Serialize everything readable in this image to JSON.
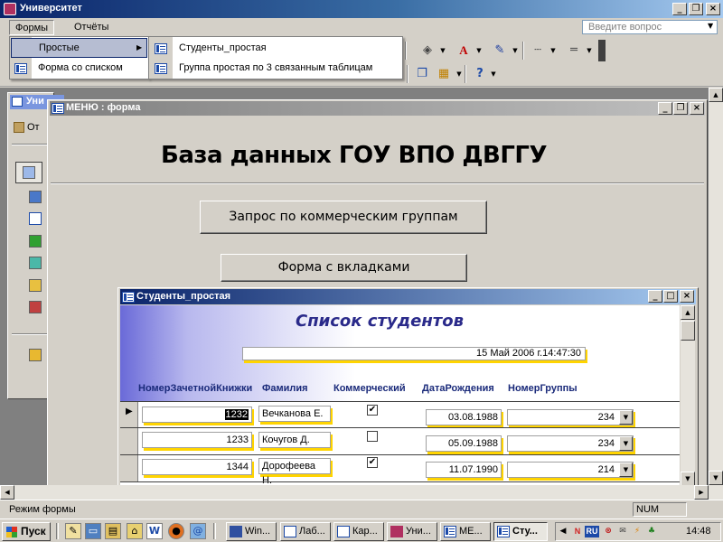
{
  "app": {
    "title": "Университет"
  },
  "menubar": {
    "forms": "Формы",
    "reports": "Отчёты",
    "help_placeholder": "Введите вопрос"
  },
  "forms_menu": {
    "simple": "Простые",
    "list_form": "Форма со списком",
    "submenu_arrow": "▶"
  },
  "simple_submenu": {
    "item1": "Студенты_простая",
    "item2": "Группа простая по 3 связанным таблицам"
  },
  "db_window": {
    "title_fragment": "Уни",
    "open_fragment": "От"
  },
  "menu_form": {
    "title": "МЕНЮ : форма",
    "heading": "База данных ГОУ ВПО ДВГГУ",
    "btn_query": "Запрос по коммерческим группам",
    "btn_tabs": "Форма с вкладками"
  },
  "students_form": {
    "title": "Студенты_простая",
    "heading": "Список студентов",
    "datetime": "15 Май 2006 г.14:47:30",
    "columns": {
      "record_book": "НомерЗачетнойКнижки",
      "surname": "Фамилия",
      "commercial": "Коммерческий",
      "birth_date": "ДатаРождения",
      "group_no": "НомерГруппы"
    },
    "records": [
      {
        "book": "1232",
        "surname": "Вечканова Е.",
        "commercial": "✔",
        "birth": "03.08.1988",
        "group": "234"
      },
      {
        "book": "1233",
        "surname": "Кочугов Д.",
        "commercial": "",
        "birth": "05.09.1988",
        "group": "234"
      },
      {
        "book": "1344",
        "surname": "Дорофеева Н.",
        "commercial": "✔",
        "birth": "11.07.1990",
        "group": "214"
      }
    ]
  },
  "statusbar": {
    "mode": "Режим формы",
    "num": "NUM"
  },
  "taskbar": {
    "start": "Пуск",
    "tasks": [
      "Win...",
      "Лаб...",
      "Кар...",
      "Уни...",
      "МЕ...",
      "Сту..."
    ],
    "clock": "14:48",
    "lang": "RU",
    "tray_n": "N"
  },
  "colors": {
    "active_caption": "#0a246a",
    "inactive_caption": "#808080",
    "field_shadow": "#ffd400",
    "heading_blue": "#2a2a8a"
  }
}
